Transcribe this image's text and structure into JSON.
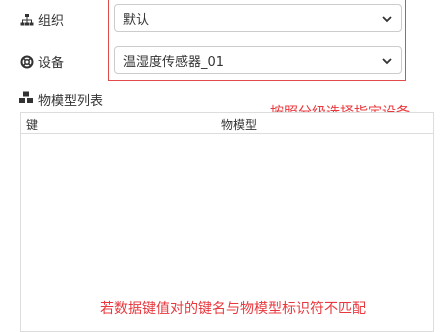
{
  "form": {
    "org_label": "组织",
    "org_value": "默认",
    "device_label": "设备",
    "device_value": "温湿度传感器_01"
  },
  "model_list": {
    "title": "物模型列表",
    "columns": [
      "键",
      "物模型"
    ]
  },
  "annotations": {
    "select_hint": "按照分级选择指定设备",
    "mismatch_hint": "若数据键值对的键名与物模型标识符不匹配"
  },
  "colors": {
    "annotation": "#e8383d",
    "border": "#cccccc"
  },
  "icons": {
    "org": "sitemap-icon",
    "device": "life-ring-icon",
    "model_list": "cubes-icon",
    "select": "chevron-down-icon"
  }
}
